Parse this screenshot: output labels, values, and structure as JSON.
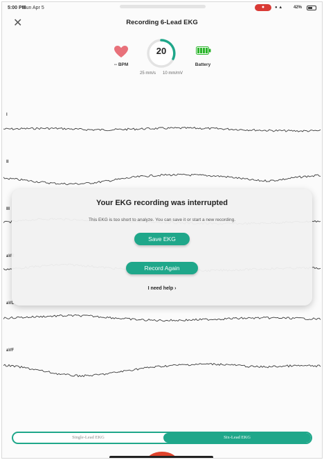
{
  "status_bar": {
    "time": "5:00 PM",
    "date": "Sun Apr 5",
    "battery_pct": "42%"
  },
  "header": {
    "title": "Recording 6-Lead EKG",
    "close_icon": "✕"
  },
  "vitals": {
    "bpm_label": "-- BPM",
    "timer_value": "20",
    "speed": "25 mm/s",
    "gain": "10 mm/mV",
    "battery_label": "Battery"
  },
  "leads": [
    "I",
    "II",
    "III",
    "aVR",
    "aVL",
    "aVF"
  ],
  "dialog": {
    "title": "Your EKG recording was interrupted",
    "message": "This EKG is too short to analyze. You can save it or start a new recording.",
    "save_button": "Save EKG",
    "record_button": "Record Again",
    "help_link": "I need help"
  },
  "mode_toggle": {
    "single": "Single-Lead EKG",
    "six": "Six-Lead EKG",
    "selected": "Six-Lead EKG"
  },
  "colors": {
    "accent": "#1fa78a",
    "heart": "#e8717a",
    "recording": "#d93a35"
  }
}
